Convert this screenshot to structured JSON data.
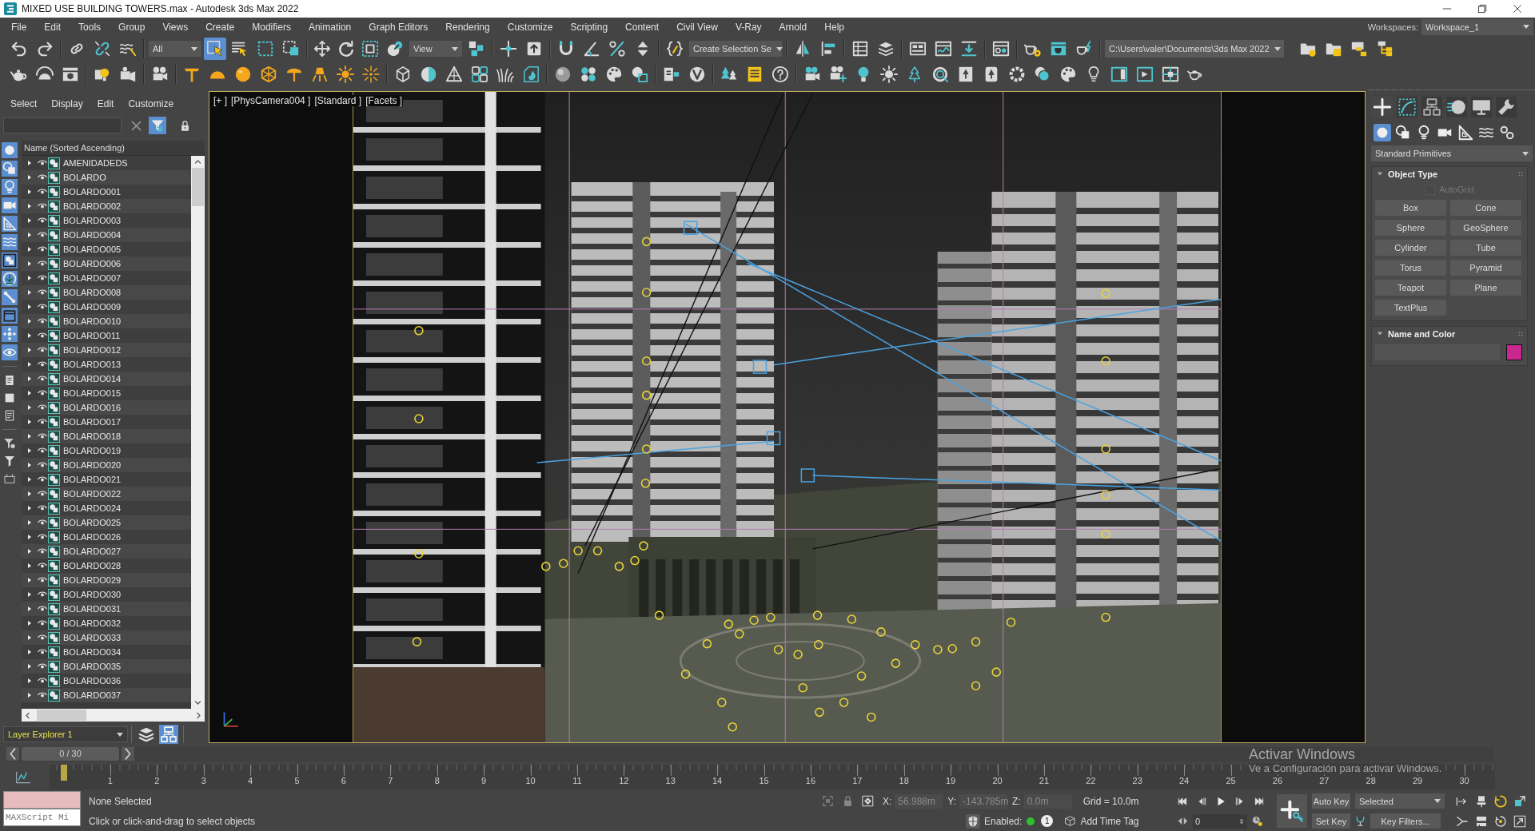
{
  "window": {
    "title": "MIXED USE BUILDING TOWERS.max - Autodesk 3ds Max 2022"
  },
  "menu_bar": {
    "items": [
      "File",
      "Edit",
      "Tools",
      "Group",
      "Views",
      "Create",
      "Modifiers",
      "Animation",
      "Graph Editors",
      "Rendering",
      "Customize",
      "Scripting",
      "Content",
      "Civil View",
      "V-Ray",
      "Arnold",
      "Help"
    ],
    "workspaces_label": "Workspaces:",
    "workspace": "Workspace_1"
  },
  "main_toolbar": {
    "selection_filter": "All",
    "tools": [
      {
        "selected": true
      },
      {
        "selected": false
      },
      {
        "selected": false
      },
      {
        "selected": false
      }
    ],
    "reference_coordinate_system": "View",
    "named_selection_set": "Create Selection Se",
    "project_folder": "C:\\Users\\valer\\Documents\\3ds Max 2022"
  },
  "scene_explorer": {
    "menu": [
      "Select",
      "Display",
      "Edit",
      "Customize"
    ],
    "filter_toggles": [
      {
        "on": true
      },
      {
        "on": true
      },
      {
        "on": true
      },
      {
        "on": true
      },
      {
        "on": true
      },
      {
        "on": true
      },
      {
        "on": true
      },
      {
        "on": true
      },
      {
        "on": true
      },
      {
        "on": true
      },
      {
        "on": true
      },
      {
        "on": true
      }
    ],
    "column_header": "Name (Sorted Ascending)",
    "rows": [
      "AMENIDADEDS",
      "BOLARDO",
      "BOLARDO001",
      "BOLARDO002",
      "BOLARDO003",
      "BOLARDO004",
      "BOLARDO005",
      "BOLARDO006",
      "BOLARDO007",
      "BOLARDO008",
      "BOLARDO009",
      "BOLARDO010",
      "BOLARDO011",
      "BOLARDO012",
      "BOLARDO013",
      "BOLARDO014",
      "BOLARDO015",
      "BOLARDO016",
      "BOLARDO017",
      "BOLARDO018",
      "BOLARDO019",
      "BOLARDO020",
      "BOLARDO021",
      "BOLARDO022",
      "BOLARDO024",
      "BOLARDO025",
      "BOLARDO026",
      "BOLARDO027",
      "BOLARDO028",
      "BOLARDO029",
      "BOLARDO030",
      "BOLARDO031",
      "BOLARDO032",
      "BOLARDO033",
      "BOLARDO034",
      "BOLARDO035",
      "BOLARDO036",
      "BOLARDO037"
    ],
    "layer_explorer": "Layer Explorer 1"
  },
  "viewport": {
    "labels": [
      "[+ ]",
      "[PhysCamera004 ]",
      "[Standard ]",
      "[Facets ]"
    ]
  },
  "command_panel": {
    "tabs": [
      {
        "selected": true
      },
      {
        "selected": false
      },
      {
        "selected": false
      },
      {
        "selected": false
      },
      {
        "selected": false
      },
      {
        "selected": false
      }
    ],
    "categories": [
      {
        "selected": true
      },
      {
        "selected": false
      },
      {
        "selected": false
      },
      {
        "selected": false
      },
      {
        "selected": false
      },
      {
        "selected": false
      },
      {
        "selected": false
      }
    ],
    "object_class": "Standard Primitives",
    "object_type": {
      "title": "Object Type",
      "expanded": true,
      "autogrid": {
        "label": "AutoGrid",
        "checked": false,
        "disabled": true
      },
      "buttons": [
        "Box",
        "Cone",
        "Sphere",
        "GeoSphere",
        "Cylinder",
        "Tube",
        "Torus",
        "Pyramid",
        "Teapot",
        "Plane",
        "TextPlus"
      ]
    },
    "name_and_color": {
      "title": "Name and Color",
      "expanded": true,
      "color": "#c8288e"
    }
  },
  "time_slider": {
    "label": "0 / 30",
    "level": 0
  },
  "track_bar": {
    "frames": [
      "1",
      "2",
      "3",
      "4",
      "5",
      "6",
      "7",
      "8",
      "9",
      "10",
      "11",
      "12",
      "13",
      "14",
      "15",
      "16",
      "17",
      "18",
      "19",
      "20",
      "21",
      "22",
      "23",
      "24",
      "25",
      "26",
      "27",
      "28",
      "29",
      "30"
    ]
  },
  "activation_notice": {
    "title": "Activar Windows",
    "message": "Ve a Configuración para activar Windows."
  },
  "status_bar": {
    "maxscript_placeholder": "MAXScript Mi",
    "selection": "None Selected",
    "prompt": "Click or click-and-drag to select objects",
    "x_label": "X:",
    "x": "56.988m",
    "y_label": "Y:",
    "y": "-143.785m",
    "z_label": "Z:",
    "z": "0.0m",
    "grid": "Grid = 10.0m",
    "adaptive_degradation": {
      "label": "Enabled:",
      "on": true,
      "badge": "1"
    },
    "add_time_tag": "Add Time Tag"
  },
  "animation_controls": {
    "frame": "0",
    "auto_key": "Auto Key",
    "key_set": "Selected",
    "set_key": "Set Key",
    "key_filters": "Key Filters..."
  }
}
